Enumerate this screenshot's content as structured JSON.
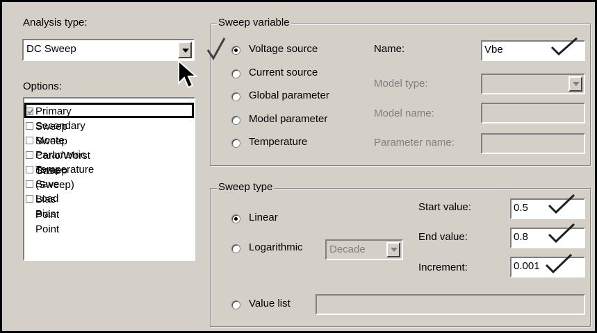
{
  "analysis_type": {
    "label": "Analysis type:",
    "value": "DC Sweep"
  },
  "options": {
    "label": "Options:",
    "items": [
      {
        "label": "Primary Sweep",
        "checked": true
      },
      {
        "label": "Secondary Sweep",
        "checked": false
      },
      {
        "label": "Monte Carlo/Worst Case",
        "checked": false
      },
      {
        "label": "Parametric Sweep",
        "checked": false
      },
      {
        "label": "Temperature (Sweep)",
        "checked": false
      },
      {
        "label": "Save Bias Point",
        "checked": false
      },
      {
        "label": "Load Bias Point",
        "checked": false
      }
    ]
  },
  "sweep_variable": {
    "title": "Sweep variable",
    "radios": [
      {
        "label": "Voltage source",
        "selected": true
      },
      {
        "label": "Current source",
        "selected": false
      },
      {
        "label": "Global parameter",
        "selected": false
      },
      {
        "label": "Model parameter",
        "selected": false
      },
      {
        "label": "Temperature",
        "selected": false
      }
    ],
    "name_label": "Name:",
    "name_value": "Vbe",
    "model_type_label": "Model type:",
    "model_name_label": "Model name:",
    "parameter_name_label": "Parameter name:"
  },
  "sweep_type": {
    "title": "Sweep type",
    "linear_label": "Linear",
    "logarithmic_label": "Logarithmic",
    "log_scale_value": "Decade",
    "start_label": "Start value:",
    "start_value": "0.5",
    "end_label": "End value:",
    "end_value": "0.8",
    "increment_label": "Increment:",
    "increment_value": "0.001",
    "value_list_label": "Value list",
    "value_list_value": ""
  },
  "icons": [
    "checkmark-icon",
    "dropdown-arrow-icon",
    "mouse-pointer-icon"
  ]
}
